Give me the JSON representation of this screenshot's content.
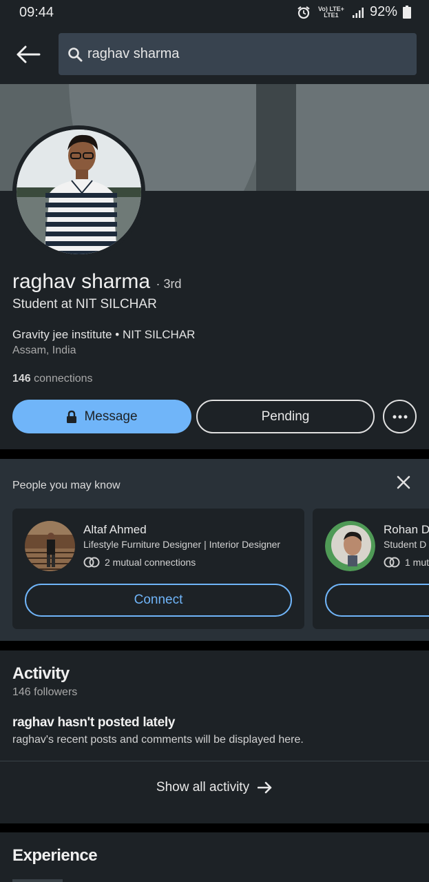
{
  "status_bar": {
    "time": "09:44",
    "network": "Vo) LTE+ LTE1",
    "battery": "92%"
  },
  "search": {
    "query": "raghav sharma"
  },
  "profile": {
    "name": "raghav sharma",
    "degree": "· 3rd",
    "headline": "Student at NIT SILCHAR",
    "education": "Gravity jee institute • NIT SILCHAR",
    "location": "Assam, India",
    "connections_count": "146",
    "connections_label": "connections",
    "message_label": "Message",
    "pending_label": "Pending"
  },
  "pymk": {
    "title": "People you may know",
    "people": [
      {
        "name": "Altaf Ahmed",
        "title": "Lifestyle Furniture Designer | Interior Designer",
        "mutual": "2 mutual connections",
        "connect_label": "Connect"
      },
      {
        "name": "Rohan De",
        "title": "Student D",
        "mutual": "1 mut",
        "connect_label": "",
        "badge": "#OPENTOWORK"
      }
    ]
  },
  "activity": {
    "title": "Activity",
    "followers": "146 followers",
    "empty_title": "raghav hasn't posted lately",
    "empty_sub": "raghav's recent posts and comments will be displayed here.",
    "show_all": "Show all activity"
  },
  "experience": {
    "title": "Experience"
  },
  "colors": {
    "background": "#1d2226",
    "accent": "#70b5f9",
    "card": "#293138"
  }
}
